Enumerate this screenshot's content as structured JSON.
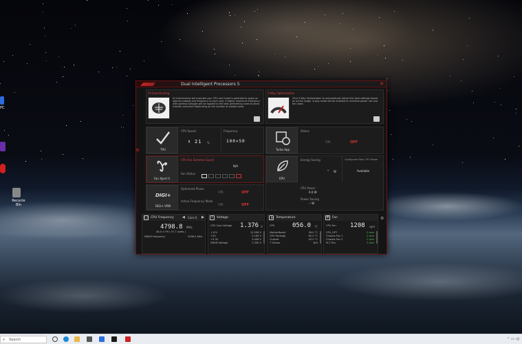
{
  "window": {
    "title": "Dual Intelligent Processors 5",
    "close_glyph": "✕"
  },
  "ai_overclocking": {
    "heading": "AI Overclocking",
    "description": "AI Overclocking will evaluate your CPU and Cooler's potential to apply an optimal voltage and frequency to each core. A higher maximum frequency with optimal voltages will be applied to the best performing cores to allow a better overclock depending on the number of loaded cores."
  },
  "five_way": {
    "heading": "5-Way Optimization",
    "description": "Click 5-Way Optimization to automatically detect the best settings based on actual usage. A-way mode will be enabled to minimize power use and fan noise."
  },
  "tpu": {
    "label": "TPU",
    "cpu_speed_label": "CPU Speed",
    "cpu_speed_value": "21",
    "cpu_speed_unit": "%",
    "frequency_label": "Frequency",
    "frequency_value": "100×50"
  },
  "turbo_app": {
    "label": "Turbo App",
    "status_label": "Status",
    "on": "ON",
    "off": "OFF"
  },
  "fan_xpert": {
    "label": "Fan Xpert 4",
    "cpu_fan_guard_label": "CPU Fan Extreme Guard",
    "cpu_fan_guard_value": "N/A",
    "fan_status_label": "Fan Status"
  },
  "epu": {
    "label": "EPU",
    "energy_saving_label": "Energy Saving",
    "energy_saving_value": "-",
    "energy_saving_unit": "W",
    "configured_max_label": "Configured Max CPU Power",
    "configured_max_value": "Available",
    "cpu_power_label": "CPU Power",
    "cpu_power_value": "0.0 W",
    "power_saving_label": "Power Saving",
    "power_saving_value": "-- W"
  },
  "digi_vrm": {
    "label": "DIGI+ VRM",
    "logo_text": "DIGI+",
    "optimized_phase_label": "Optimized Phase",
    "active_freq_label": "Active Frequency Mode",
    "on": "ON",
    "off": "OFF"
  },
  "monitors": {
    "cpu_freq": {
      "title": "CPU Frequency",
      "core": "Core 0",
      "value": "4798.8",
      "unit": "MHz",
      "sub": "48.0 × 99  ( 37.7  watts )",
      "dram_label": "DRAM Frequency",
      "dram_value": "2996.4 MHz"
    },
    "voltage": {
      "title": "Voltage",
      "main_label": "CPU Core Voltage",
      "main_value": "1.376",
      "main_unit": "V",
      "rows": [
        {
          "label": "+12V",
          "value": "12.096  V"
        },
        {
          "label": "+5V",
          "value": "5.160  V"
        },
        {
          "label": "+3.3V",
          "value": "3.408  V"
        },
        {
          "label": "DRAM Voltage",
          "value": "1.340  V"
        }
      ]
    },
    "temperature": {
      "title": "Temperature",
      "main_label": "CPU",
      "main_value": "056.0",
      "main_unit": "°C",
      "rows": [
        {
          "label": "MotherBoard",
          "value": "36.0 °C"
        },
        {
          "label": "CPU Package",
          "value": "65.0 °C"
        },
        {
          "label": "Chipset",
          "value": "45.0 °C"
        },
        {
          "label": "T Sensor",
          "value": "N/A"
        }
      ]
    },
    "fan": {
      "title": "Fan",
      "main_label": "CPU Fan",
      "main_value": "1208",
      "main_unit": "rpm",
      "rows": [
        {
          "label": "CPU_OPT",
          "value": "0  rpm"
        },
        {
          "label": "Chassis Fan 1",
          "value": "0  rpm"
        },
        {
          "label": "Chassis Fan 2",
          "value": "0  rpm"
        },
        {
          "label": "M.2 Fan",
          "value": "0  rpm"
        }
      ]
    }
  },
  "desktop": {
    "icons": [
      {
        "label": "PC",
        "color": "#2d6cdf"
      },
      {
        "label": "",
        "color": "#6a2da8"
      },
      {
        "label": "",
        "color": "#d02020"
      },
      {
        "label": "Recycle Bin",
        "color": "#bbbbbb"
      }
    ]
  },
  "taskbar": {
    "search_placeholder": "Search",
    "accent": "#0a64c8"
  }
}
